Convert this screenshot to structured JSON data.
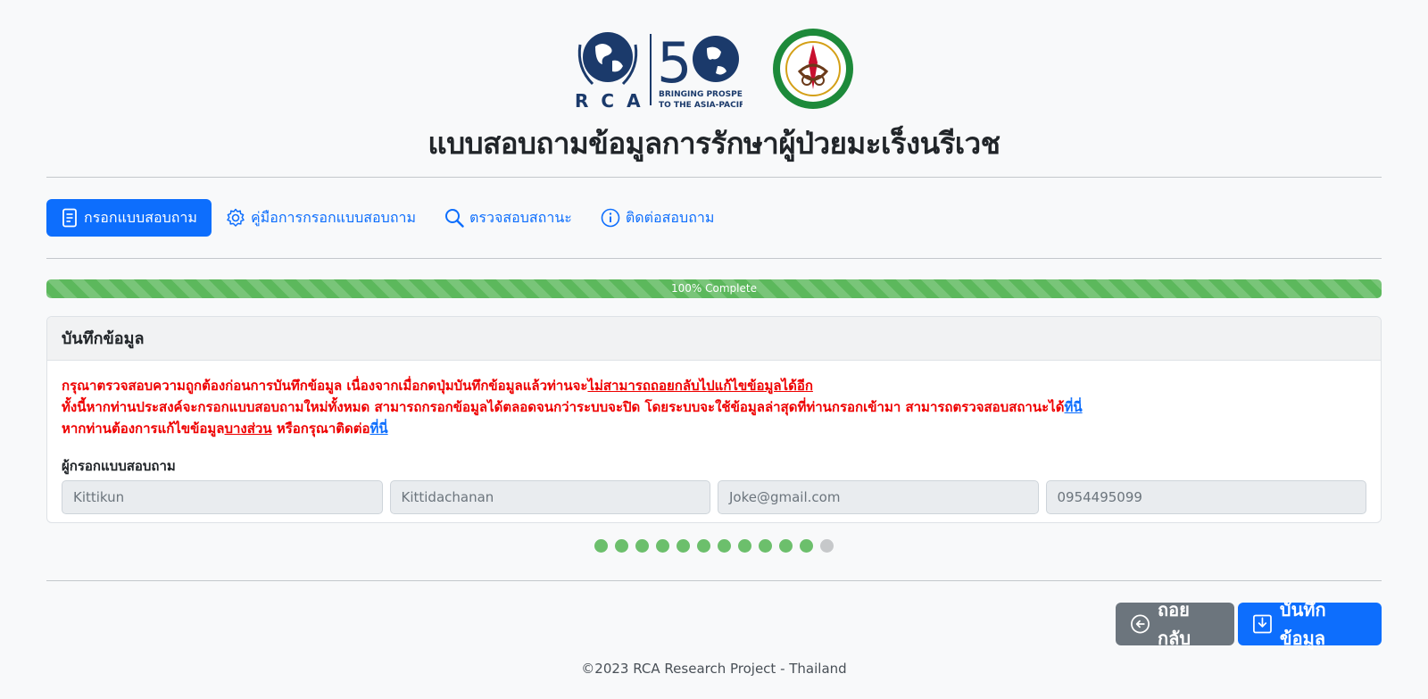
{
  "header": {
    "logo_rca_text": "RCA",
    "logo_tagline_1": "BRINGING PROSPERITY",
    "logo_tagline_2": "TO THE ASIA-PACIFIC",
    "logo_fifty": "50",
    "title": "แบบสอบถามข้อมูลการรักษาผู้ป่วยมะเร็งนรีเวช"
  },
  "nav": {
    "items": [
      {
        "label": "กรอกแบบสอบถาม",
        "icon": "document-icon",
        "active": true
      },
      {
        "label": "คู่มือการกรอกแบบสอบถาม",
        "icon": "gear-icon",
        "active": false
      },
      {
        "label": "ตรวจสอบสถานะ",
        "icon": "search-icon",
        "active": false
      },
      {
        "label": "ติดต่อสอบถาม",
        "icon": "info-icon",
        "active": false
      }
    ]
  },
  "progress": {
    "label": "100% Complete",
    "value": 100
  },
  "card": {
    "title": "บันทึกข้อมูล",
    "warning_line1_a": "กรุณาตรวจสอบความถูกต้องก่อนการบันทึกข้อมูล เนื่องจากเมื่อกดปุ่มบันทึกข้อมูลแล้วท่านจะ",
    "warning_line1_b": "ไม่สามารถถอยกลับไปแก้ไขข้อมูลได้อีก",
    "warning_line2_a": "ทั้งนี้หากท่านประสงค์จะกรอกแบบสอบถามใหม่ทั้งหมด สามารถกรอกข้อมูลได้ตลอดจนกว่าระบบจะปิด โดยระบบจะใช้ข้อมูลล่าสุดที่ท่านกรอกเข้ามา สามารถตรวจสอบสถานะได้",
    "warning_line2_link": "ที่นี่",
    "warning_line3_a": "หากท่านต้องการแก้ไขข้อมูล",
    "warning_line3_b": "บางส่วน",
    "warning_line3_c": " หรือกรุณาติดต่อ",
    "warning_line3_link": "ที่นี่",
    "field_label": "ผู้กรอกแบบสอบถาม",
    "inputs": [
      {
        "placeholder": "Kittikun"
      },
      {
        "placeholder": "Kittidachanan"
      },
      {
        "placeholder": "Joke@gmail.com"
      },
      {
        "placeholder": "0954495099"
      }
    ]
  },
  "steps": {
    "total": 12,
    "completed": 11
  },
  "buttons": {
    "back": "ถอยกลับ",
    "save": "บันทึกข้อมูล"
  },
  "footer": "©2023 RCA Research Project - Thailand",
  "colors": {
    "primary": "#0d6efd",
    "success": "#5cb85c",
    "danger": "#ee0000",
    "secondary": "#6c757d"
  }
}
